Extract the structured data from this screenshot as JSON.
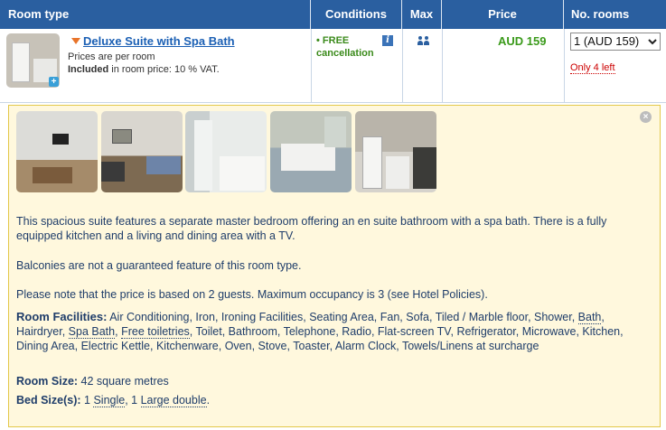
{
  "header": {
    "room_type": "Room type",
    "conditions": "Conditions",
    "max": "Max",
    "price": "Price",
    "no_rooms": "No. rooms"
  },
  "room": {
    "name": "Deluxe Suite with Spa Bath",
    "prices_note": "Prices are per room",
    "included_label": "Included",
    "included_text": " in room price: 10 % VAT.",
    "conditions": "• FREE cancellation",
    "max_guests": 2,
    "price": "AUD 159",
    "select_value": "1 (AUD 159)",
    "availability": "Only 4 left"
  },
  "details": {
    "description_1": "This spacious suite features a separate master bedroom offering an en suite bathroom with a spa bath. There is a fully equipped kitchen and a living and dining area with a TV.",
    "description_2": "Balconies are not a guaranteed feature of this room type.",
    "description_3": "Please note that the price is based on 2 guests. Maximum occupancy is 3 (see Hotel Policies).",
    "facilities_label": "Room Facilities:",
    "facilities": [
      "Air Conditioning",
      "Iron",
      "Ironing Facilities",
      "Seating Area",
      "Fan",
      "Sofa",
      "Tiled / Marble floor",
      "Shower",
      "Bath",
      "Hairdryer",
      "Spa Bath",
      "Free toiletries",
      "Toilet",
      "Bathroom",
      "Telephone",
      "Radio",
      "Flat-screen TV",
      "Refrigerator",
      "Microwave",
      "Kitchen",
      "Dining Area",
      "Electric Kettle",
      "Kitchenware",
      "Oven",
      "Stove",
      "Toaster",
      "Alarm Clock",
      "Towels/Linens at surcharge"
    ],
    "room_size_label": "Room Size:",
    "room_size": " 42 square metres",
    "bed_label": "Bed Size(s):",
    "bed_1_count": " 1 ",
    "bed_1": "Single",
    "bed_sep": ", 1 ",
    "bed_2": "Large double",
    "bed_end": "."
  },
  "colors": {
    "header_bg": "#2a5fa0",
    "link": "#1a5fb4",
    "price": "#3a9a1a",
    "free_cancel": "#3a8a1a",
    "warning": "#cc0000",
    "panel_bg": "#fff8dd",
    "panel_border": "#e3c84a"
  },
  "icons": [
    "expand-arrow-icon",
    "info-icon",
    "guests-icon",
    "select-chevron-icon",
    "close-icon",
    "zoom-plus-icon"
  ]
}
